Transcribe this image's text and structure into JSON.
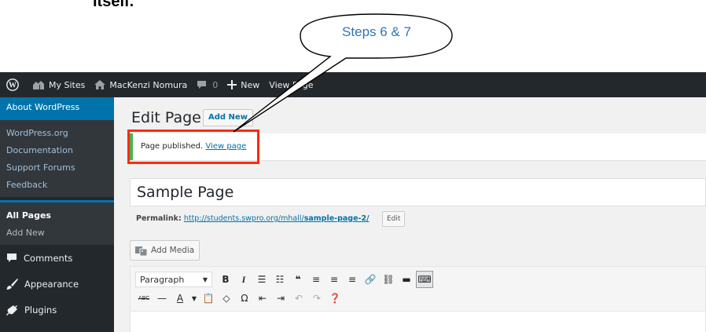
{
  "doc": {
    "fragment": "itself."
  },
  "callout": {
    "text": "Steps 6 & 7"
  },
  "adminbar": {
    "my_sites": "My Sites",
    "site_name": "MacKenzi Nomura",
    "comments_count": "0",
    "new_label": "New",
    "view_page": "View Page"
  },
  "sidebar": {
    "flyout_head": "About WordPress",
    "flyout_items": [
      "WordPress.org",
      "Documentation",
      "Support Forums",
      "Feedback"
    ],
    "pages_items": [
      "All Pages",
      "Add New"
    ],
    "menu": [
      "Comments",
      "Appearance",
      "Plugins"
    ]
  },
  "main": {
    "title": "Edit Page",
    "add_new": "Add New",
    "notice_text": "Page published.",
    "notice_link": "View page",
    "page_title_value": "Sample Page",
    "permalink_label": "Permalink:",
    "permalink_base": "http://students.swpro.org/mhall/",
    "permalink_slug": "sample-page-2/",
    "permalink_edit": "Edit",
    "add_media": "Add Media",
    "format_select": "Paragraph"
  },
  "colors": {
    "adminbar_bg": "#23282d",
    "accent": "#0073aa",
    "notice_border": "#46b450",
    "highlight": "#ff2a0a",
    "callout_text": "#2e75b6"
  }
}
